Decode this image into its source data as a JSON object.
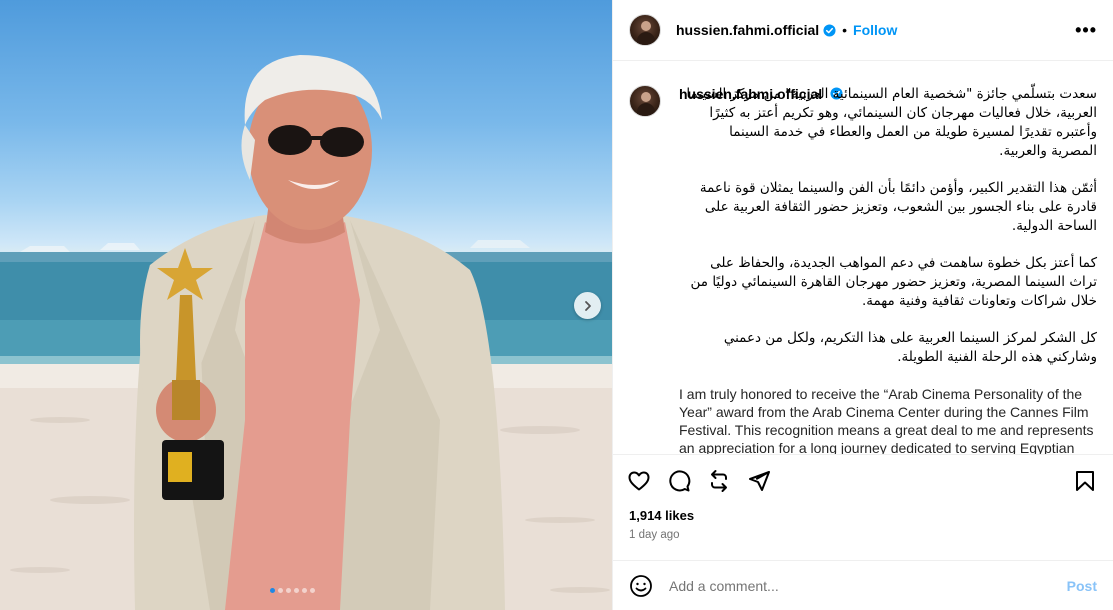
{
  "post": {
    "username": "hussien.fahmi.official",
    "follow_label": "Follow",
    "separator": "•",
    "more_label": "•••",
    "caption": {
      "ar_p1": "سعدت بتسلّمي جائزة \"شخصية العام السينمائية العربية\" من مركز السينما العربية، خلال فعاليات مهرجان كان السينمائي، وهو تكريم أعتز به كثيرًا وأعتبره تقديرًا لمسيرة طويلة من العمل والعطاء في خدمة السينما المصرية والعربية.",
      "ar_p2": "أثمّن هذا التقدير الكبير، وأؤمن دائمًا بأن الفن والسينما يمثلان قوة ناعمة قادرة على بناء الجسور بين الشعوب، وتعزيز حضور الثقافة العربية على الساحة الدولية.",
      "ar_p3": "كما أعتز بكل خطوة ساهمت في دعم المواهب الجديدة، والحفاظ على تراث السينما المصرية، وتعزيز حضور مهرجان القاهرة السينمائي دوليًا من خلال شراكات وتعاونات ثقافية وفنية مهمة.",
      "ar_p4": "كل الشكر لمركز السينما العربية على هذا التكريم، ولكل من دعمني وشاركني هذه الرحلة الفنية الطويلة.",
      "en_p1": "I am truly honored to receive the “Arab Cinema Personality of the Year” award from the Arab Cinema Center during the Cannes Film Festival. This recognition means a great deal to me and represents an appreciation for a long journey dedicated to serving Egyptian and Arab cinema."
    },
    "likes": "1,914 likes",
    "time": "1 day ago",
    "comment_placeholder": "Add a comment...",
    "post_label": "Post"
  },
  "carousel": {
    "dot_count": 6,
    "active_index": 0
  },
  "icons": {
    "verified": "verified-badge-icon",
    "heart": "heart-icon",
    "comment": "comment-icon",
    "repost": "repost-icon",
    "share": "share-icon",
    "bookmark": "bookmark-icon",
    "emoji": "emoji-icon",
    "next": "chevron-right-icon"
  },
  "colors": {
    "accent": "#0095f6",
    "post_disabled": "#89c3f8",
    "muted": "#737373"
  }
}
